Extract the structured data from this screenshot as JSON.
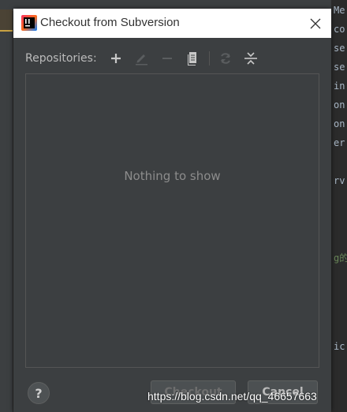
{
  "dialog": {
    "title": "Checkout from Subversion",
    "app_icon": "intellij-idea-icon",
    "close_icon": "close-icon"
  },
  "toolbar": {
    "label": "Repositories:",
    "buttons": [
      {
        "name": "add",
        "icon": "plus-icon",
        "enabled": true
      },
      {
        "name": "edit",
        "icon": "pencil-icon",
        "enabled": false
      },
      {
        "name": "remove",
        "icon": "minus-icon",
        "enabled": false
      },
      {
        "name": "browse",
        "icon": "document-icon",
        "enabled": true
      },
      {
        "name": "refresh",
        "icon": "refresh-icon",
        "enabled": false
      },
      {
        "name": "collapse",
        "icon": "collapse-icon",
        "enabled": true
      }
    ]
  },
  "repo_list": {
    "empty_text": "Nothing to show"
  },
  "footer": {
    "help_label": "?",
    "checkout_label": "Checkout",
    "cancel_label": "Cancel"
  },
  "background_code": {
    "lines": [
      {
        "text": "Me",
        "style": "normal"
      },
      {
        "text": "co",
        "style": "normal"
      },
      {
        "text": "se",
        "style": "normal"
      },
      {
        "text": "se",
        "style": "normal"
      },
      {
        "text": "in",
        "style": "normal"
      },
      {
        "text": "on",
        "style": "normal"
      },
      {
        "text": "on",
        "style": "normal"
      },
      {
        "text": "er",
        "style": "normal"
      },
      {
        "text": "rv",
        "style": "normal"
      },
      {
        "text": "g的",
        "style": "green"
      },
      {
        "text": "ic",
        "style": "normal"
      }
    ]
  },
  "watermark": "https://blog.csdn.net/qq_46657663",
  "colors": {
    "dialog_bg": "#3c3f41",
    "titlebar_bg": "#ffffff",
    "border": "#555555",
    "text": "#bbbbbb",
    "muted_text": "#8c8c8c"
  }
}
